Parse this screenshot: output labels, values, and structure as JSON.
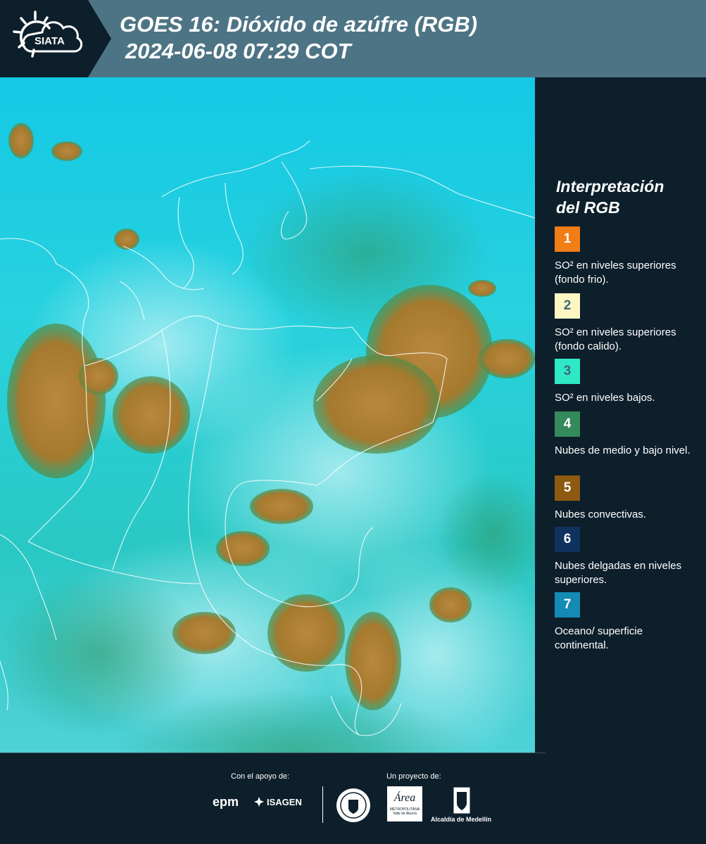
{
  "header": {
    "logo_text": "SIATA",
    "title_line1": "GOES 16: Dióxido de azúfre (RGB)",
    "title_line2": "2024-06-08 07:29 COT"
  },
  "legend": {
    "title_line1": "Interpretación",
    "title_line2": "del RGB",
    "items": [
      {
        "number": "1",
        "color": "#f07d16",
        "text": "SO² en niveles superiores (fondo frio)."
      },
      {
        "number": "2",
        "color": "#fdf6c3",
        "text": "SO² en niveles superiores (fondo calido)."
      },
      {
        "number": "3",
        "color": "#2fe8c6",
        "text": "SO² en niveles bajos."
      },
      {
        "number": "4",
        "color": "#358a5c",
        "text": "Nubes de medio y bajo nivel."
      },
      {
        "number": "5",
        "color": "#8e5a12",
        "text": "Nubes convectivas."
      },
      {
        "number": "6",
        "color": "#0f3260",
        "text": "Nubes delgadas en niveles superiores."
      },
      {
        "number": "7",
        "color": "#148ab5",
        "text": "Oceano/ superficie continental."
      }
    ]
  },
  "footer": {
    "support_label": "Con el apoyo de:",
    "project_label": "Un proyecto de:",
    "logos": {
      "epm": "epm",
      "isagen": "ISAGEN",
      "metropolitana_name": "Área",
      "metropolitana_sub": "METROPOLITANA",
      "metropolitana_sub2": "Valle de Aburrá",
      "alcaldia": "Alcaldía de Medellín"
    }
  }
}
